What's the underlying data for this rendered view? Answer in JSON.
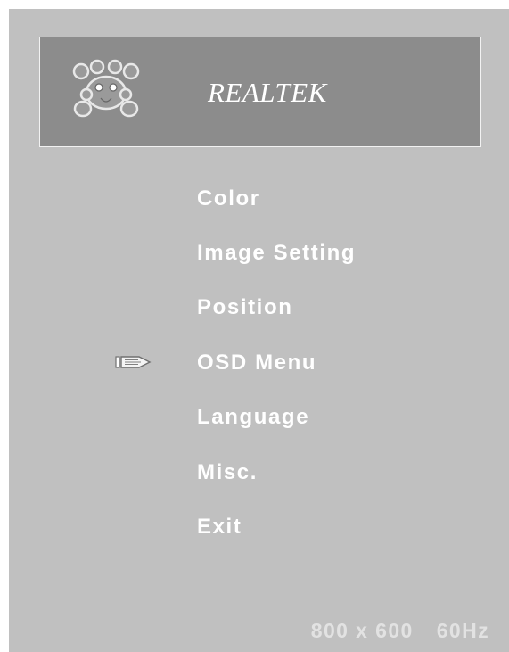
{
  "header": {
    "brand": "REALTEK",
    "logo_icon": "realtek-crab-logo-icon"
  },
  "menu": {
    "items": [
      {
        "label": "Color"
      },
      {
        "label": "Image Setting"
      },
      {
        "label": "Position"
      },
      {
        "label": "OSD Menu",
        "selected": true
      },
      {
        "label": "Language"
      },
      {
        "label": "Misc."
      },
      {
        "label": "Exit"
      }
    ],
    "pointer_icon": "pointer-hand-icon"
  },
  "status": {
    "resolution": "800 x 600",
    "refresh_rate": "60Hz"
  },
  "colors": {
    "panel": "#c0c0c0",
    "header": "#8c8c8c",
    "text": "#ffffff",
    "status_text": "#e2e2e2"
  }
}
